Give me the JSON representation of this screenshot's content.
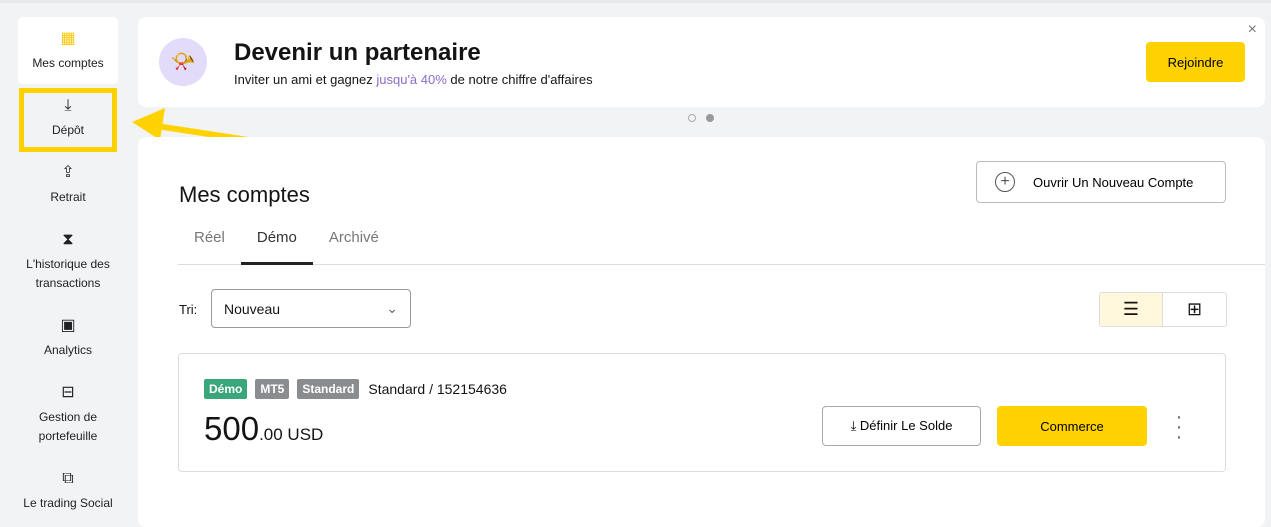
{
  "sidebar": {
    "items": [
      {
        "label": "Mes comptes",
        "icon": "accounts-grid-icon"
      },
      {
        "label": "Dépôt",
        "icon": "download-icon"
      },
      {
        "label": "Retrait",
        "icon": "withdraw-icon"
      },
      {
        "label": "L'historique des transactions",
        "icon": "hourglass-icon"
      },
      {
        "label": "Analytics",
        "icon": "analytics-icon"
      },
      {
        "label": "Gestion de portefeuille",
        "icon": "briefcase-icon"
      },
      {
        "label": "Le trading Social",
        "icon": "copy-icon"
      }
    ]
  },
  "banner": {
    "title": "Devenir un partenaire",
    "sub_pre": "Inviter un ami et gagnez ",
    "sub_hl": "jusqu'à 40%",
    "sub_post": " de notre chiffre d'affaires",
    "button": "Rejoindre",
    "close": "×"
  },
  "main": {
    "title": "Mes comptes",
    "new_account": "Ouvrir Un Nouveau Compte",
    "tabs": [
      "Réel",
      "Démo",
      "Archivé"
    ],
    "sort_label": "Tri:",
    "sort_value": "Nouveau",
    "account": {
      "badges": [
        "Démo",
        "MT5",
        "Standard"
      ],
      "name": "Standard / 152154636",
      "balance_int": "500",
      "balance_dec": ".00 USD",
      "set_balance": "Définir Le Solde",
      "trade": "Commerce"
    }
  },
  "colors": {
    "accent": "#ffd200",
    "demo": "#3aa77a",
    "purple": "#8a6cc8"
  }
}
